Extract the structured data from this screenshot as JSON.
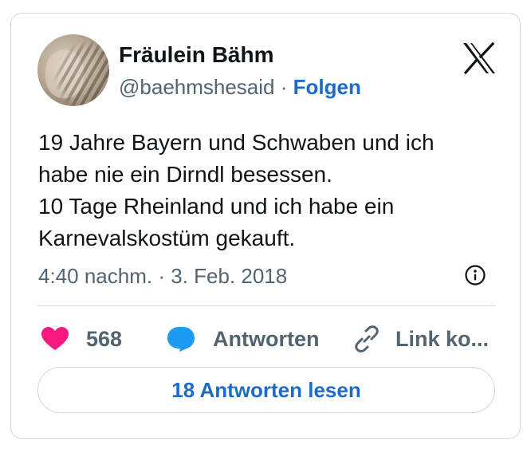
{
  "tweet": {
    "author_name": "Fräulein Bähm",
    "handle": "@baehmshesaid",
    "separator": "·",
    "follow_label": "Folgen",
    "text_lines": [
      "19 Jahre Bayern und Schwaben und ich",
      "habe nie ein Dirndl besessen.",
      "10 Tage Rheinland und ich habe ein",
      "Karnevalskostüm gekauft."
    ],
    "time": "4:40 nachm.",
    "date": "3. Feb. 2018",
    "likes": "568",
    "reply_label": "Antworten",
    "copy_link_label": "Link ko...",
    "read_replies_label": "18 Antworten lesen"
  },
  "icons": {
    "logo": "x-logo-icon",
    "info": "info-icon",
    "like": "heart-icon",
    "reply": "speech-bubble-icon",
    "copy": "link-icon"
  },
  "colors": {
    "accent": "#1d6bc9",
    "heart": "#f91880",
    "reply_bubble": "#1d9bf0",
    "secondary_text": "#536471",
    "border": "#cfd9de"
  }
}
